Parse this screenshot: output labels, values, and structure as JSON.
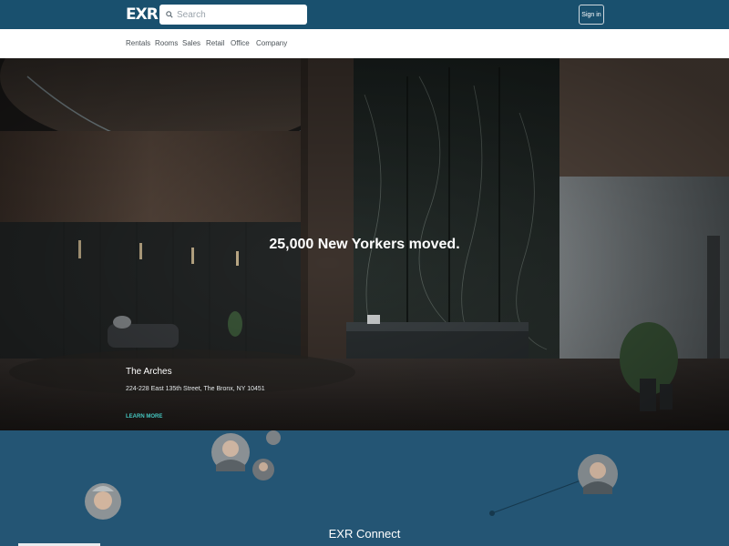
{
  "brand": {
    "logo_text": "EXR"
  },
  "search": {
    "placeholder": "Search",
    "icon": "search-icon"
  },
  "header": {
    "signin_label": "Sign in"
  },
  "nav": {
    "items": [
      {
        "label": "Rentals"
      },
      {
        "label": "Rooms"
      },
      {
        "label": "Sales"
      },
      {
        "label": "Retail"
      },
      {
        "label": "Office"
      },
      {
        "label": "Company"
      }
    ]
  },
  "hero": {
    "headline": "25,000 New Yorkers moved.",
    "property_name": "The Arches",
    "property_address": "224-228 East 135th Street, The Bronx, NY 10451",
    "cta_label": "LEARN MORE"
  },
  "connect": {
    "title": "EXR Connect"
  },
  "colors": {
    "header_bg": "#19506e",
    "connect_bg": "#245574",
    "accent": "#44c7c0"
  }
}
